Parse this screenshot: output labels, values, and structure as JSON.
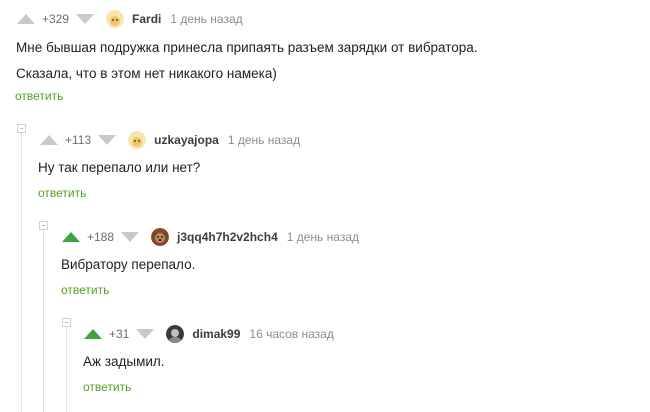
{
  "colors": {
    "accent_green": "#3fa33f",
    "reply_green": "#54a024",
    "gray_arrow": "#c9c9c9"
  },
  "comments": [
    {
      "rating": "+329",
      "author": "Fardi",
      "time": "1 день назад",
      "avatar_icon": "default-avatar-icon",
      "lines": [
        "Мне бывшая подружка принесла припаять разъем зарядки от вибратора.",
        "Сказала, что в этом нет никакого намека)"
      ],
      "reply_label": "ответить"
    },
    {
      "rating": "+113",
      "author": "uzkayajopa",
      "time": "1 день назад",
      "avatar_icon": "default-avatar-icon",
      "lines": [
        "Ну так перепало или нет?"
      ],
      "reply_label": "ответить"
    },
    {
      "rating": "+188",
      "author": "j3qq4h7h2v2hch4",
      "time": "1 день назад",
      "avatar_icon": "dog-avatar-icon",
      "lines": [
        "Вибратору перепало."
      ],
      "reply_label": "ответить"
    },
    {
      "rating": "+31",
      "author": "dimak99",
      "time": "16 часов назад",
      "avatar_icon": "photo-avatar-icon",
      "lines": [
        "Аж задымил."
      ],
      "reply_label": "ответить"
    }
  ]
}
